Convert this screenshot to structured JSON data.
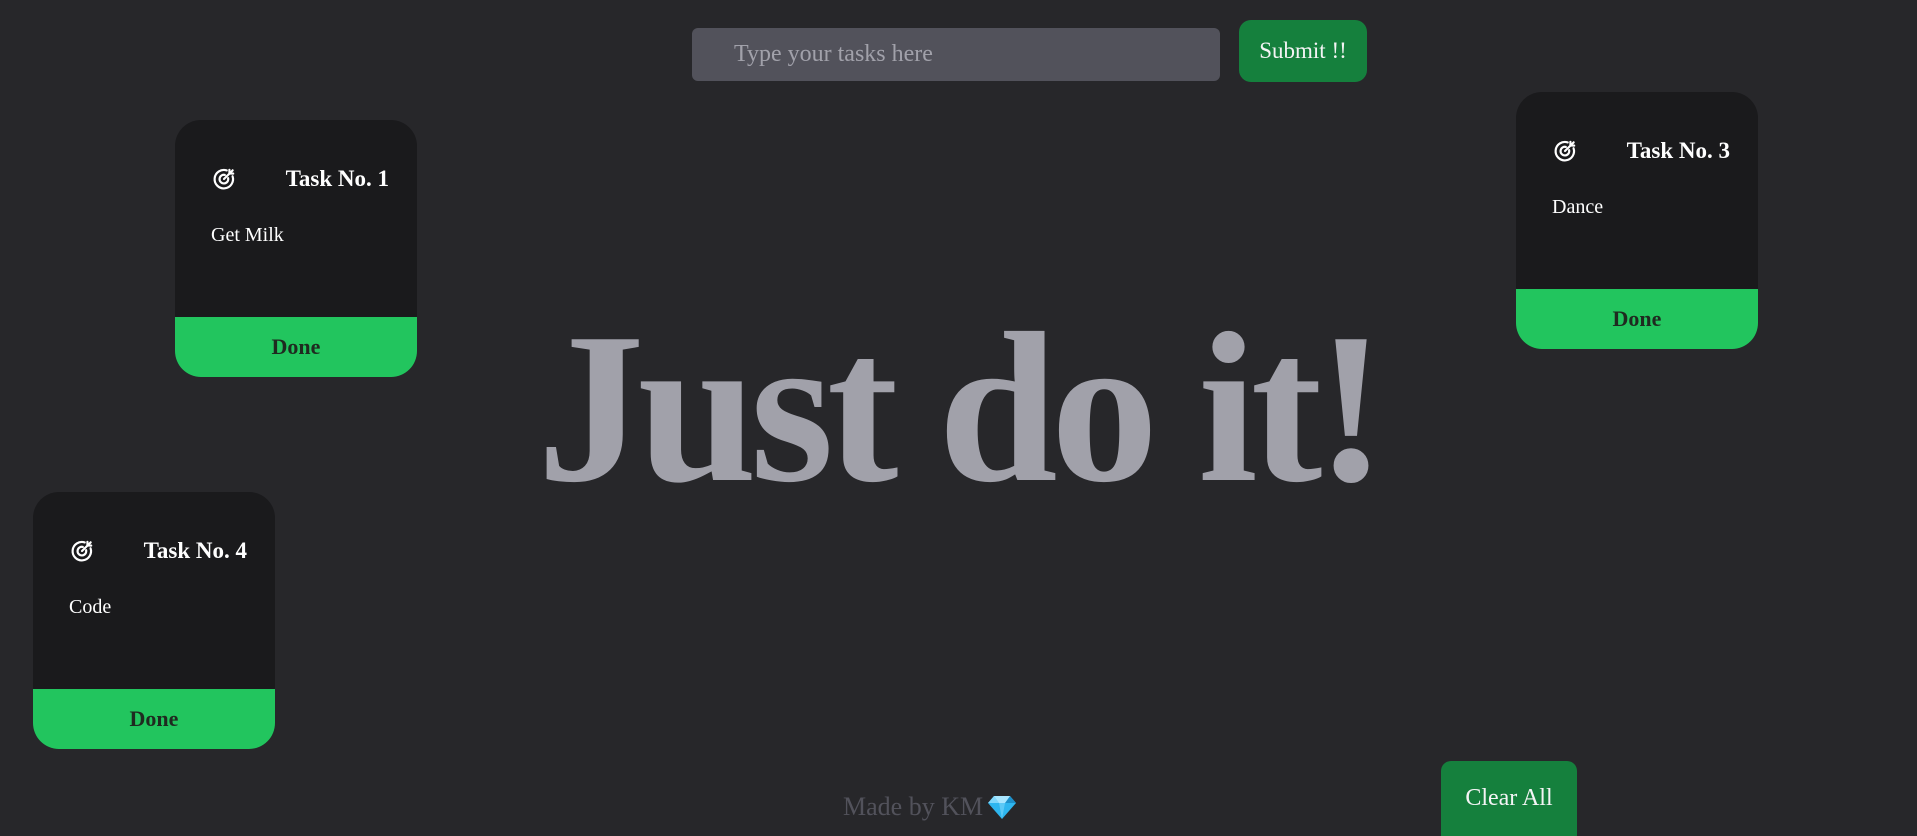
{
  "input": {
    "placeholder": "Type your tasks here",
    "value": ""
  },
  "submit_label": "Submit !!",
  "hero_text": "Just do it!",
  "tasks": [
    {
      "title": "Task No. 1",
      "text": "Get Milk",
      "done_label": "Done",
      "icon": "target-icon"
    },
    {
      "title": "Task No. 3",
      "text": "Dance",
      "done_label": "Done",
      "icon": "target-icon"
    },
    {
      "title": "Task No. 4",
      "text": "Code",
      "done_label": "Done",
      "icon": "target-icon"
    }
  ],
  "footer": {
    "credit": "Made by KM",
    "icon": "gem-icon"
  },
  "clear_all_label": "Clear All",
  "colors": {
    "background": "#27272a",
    "card": "#1a1a1c",
    "done": "#22c55e",
    "submit": "#15803d",
    "input": "#52525b",
    "hero": "#a1a1aa"
  }
}
